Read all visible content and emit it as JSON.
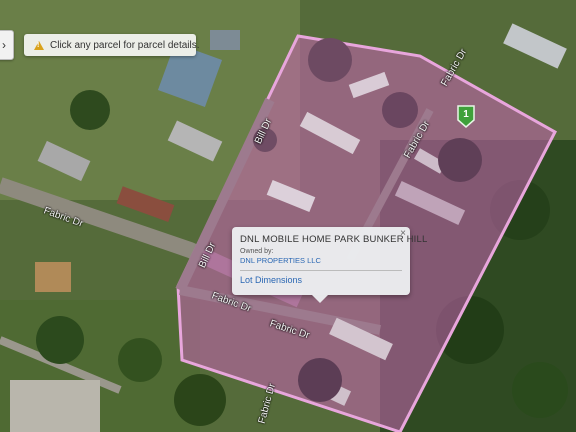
{
  "hint": {
    "text": "Click any parcel for parcel details."
  },
  "marker": {
    "label": "1"
  },
  "popup": {
    "title": "DNL MOBILE HOME PARK BUNKER HILL",
    "owner_label": "Owned by:",
    "owner": "DNL PROPERTIES LLC",
    "link": "Lot Dimensions",
    "close": "×"
  },
  "streets": {
    "fabric_top": "Fabric Dr",
    "bill_upper": "Bill Dr",
    "fabric_mid": "Fabric Dr",
    "fabric_left": "Fabric Dr",
    "bill_lower": "Bill Dr",
    "fabric_bottom_a": "Fabric Dr",
    "fabric_bottom_b": "Fabric Dr",
    "fabric_vertical": "Fabric Dr"
  },
  "colors": {
    "parcel_fill": "#c864b4",
    "parcel_stroke": "#e8a6dc",
    "marker": "#3fa13a"
  }
}
